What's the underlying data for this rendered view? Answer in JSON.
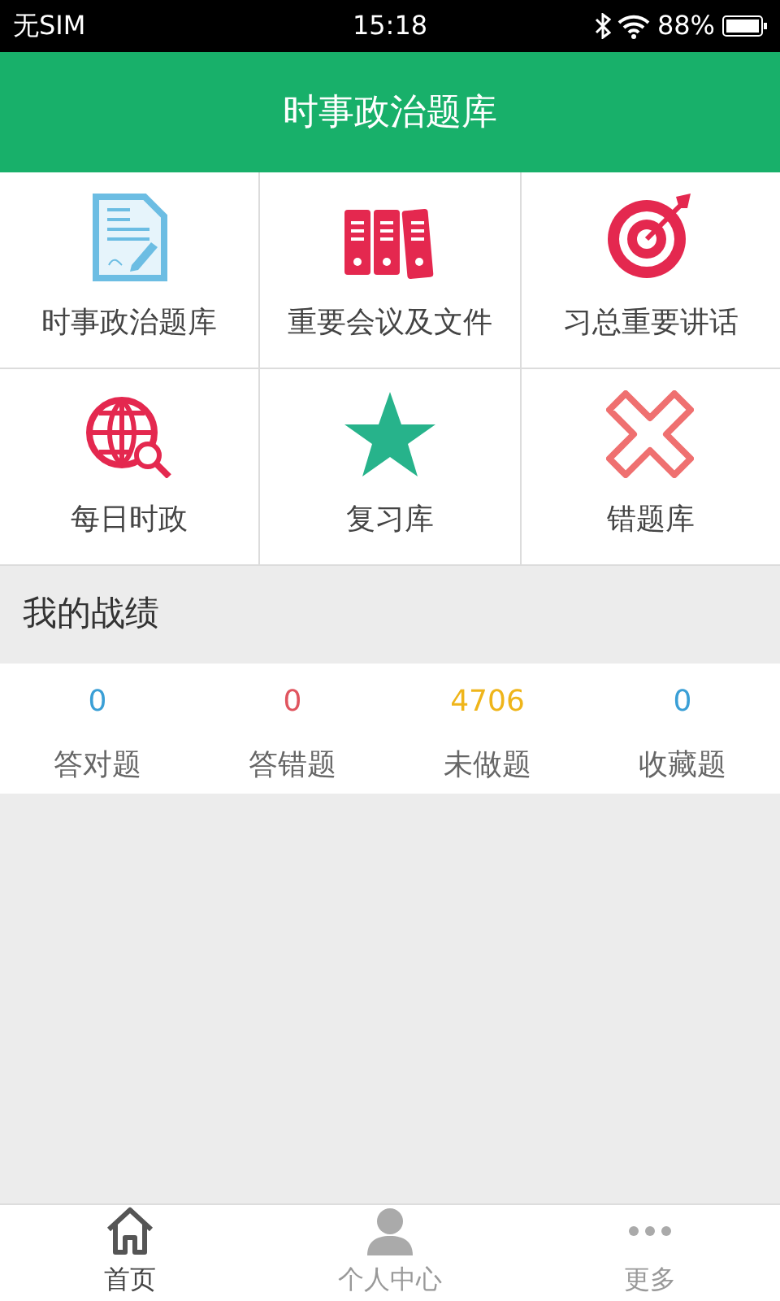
{
  "status_bar": {
    "carrier": "无SIM",
    "time": "15:18",
    "battery": "88%"
  },
  "header": {
    "title": "时事政治题库"
  },
  "tiles": [
    {
      "label": "时事政治题库",
      "kind": "document"
    },
    {
      "label": "重要会议及文件",
      "kind": "binders"
    },
    {
      "label": "习总重要讲话",
      "kind": "target"
    },
    {
      "label": "每日时政",
      "kind": "globe"
    },
    {
      "label": "复习库",
      "kind": "star"
    },
    {
      "label": "错题库",
      "kind": "cross"
    }
  ],
  "record": {
    "title": "我的战绩",
    "stats": [
      {
        "value": "0",
        "label": "答对题",
        "color": "#3a9fd6"
      },
      {
        "value": "0",
        "label": "答错题",
        "color": "#e0555f"
      },
      {
        "value": "4706",
        "label": "未做题",
        "color": "#efb51a"
      },
      {
        "value": "0",
        "label": "收藏题",
        "color": "#3a9fd6"
      }
    ]
  },
  "tab_bar": [
    {
      "label": "首页",
      "kind": "home",
      "selected": true
    },
    {
      "label": "个人中心",
      "kind": "person",
      "selected": false
    },
    {
      "label": "更多",
      "kind": "more",
      "selected": false
    }
  ]
}
